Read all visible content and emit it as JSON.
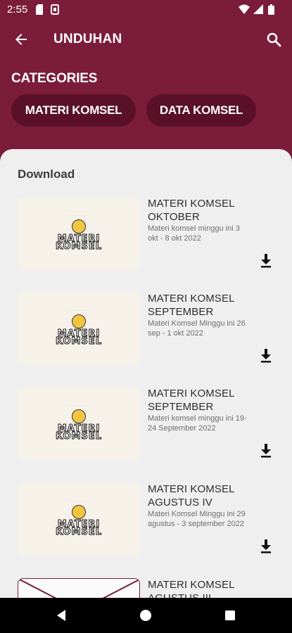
{
  "status": {
    "time": "2:55"
  },
  "appbar": {
    "title": "UNDUHAN"
  },
  "categories": {
    "title": "CATEGORIES",
    "chips": [
      "MATERI KOMSEL",
      "DATA KOMSEL"
    ]
  },
  "download": {
    "heading": "Download",
    "items": [
      {
        "title": "MATERI KOMSEL OKTOBER",
        "desc": "Materi komsel minggu ini 3 okt - 8 okt 2022",
        "thumb_text": "MATERI KOMSEL"
      },
      {
        "title": "MATERI KOMSEL SEPTEMBER",
        "desc": "Materi Komsel Minggu ini 26 sep - 1 okt 2022",
        "thumb_text": "MATERI KOMSEL"
      },
      {
        "title": "MATERI KOMSEL SEPTEMBER",
        "desc": "Materi komsel minggu ini 19-24 September 2022",
        "thumb_text": "MATERI KOMSEL"
      },
      {
        "title": "MATERI KOMSEL AGUSTUS IV",
        "desc": "Materi Komsel Minggu ini 29 agustus - 3 september 2022",
        "thumb_text": "MATERI KOMSEL"
      },
      {
        "title": "MATERI KOMSEL AGUSTUS III",
        "desc": "",
        "thumb_text": ""
      }
    ]
  },
  "colors": {
    "primary": "#7b1d3a",
    "chip": "#5a1029",
    "sheet": "#efefef"
  },
  "icons": [
    "back-arrow-icon",
    "search-icon",
    "download-icon",
    "nav-back-icon",
    "nav-home-icon",
    "nav-recents-icon"
  ]
}
